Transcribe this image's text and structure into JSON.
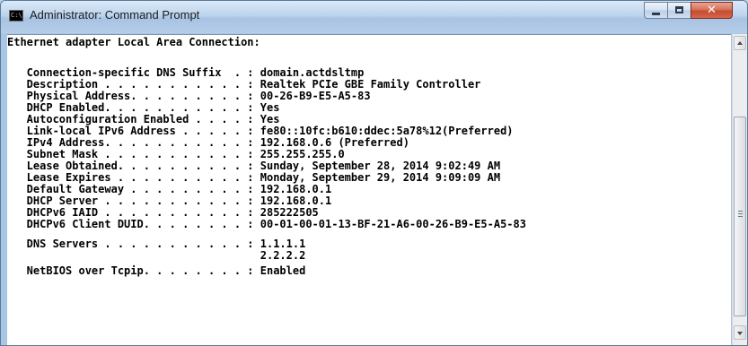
{
  "window": {
    "title": "Administrator: Command Prompt",
    "icon": "cmd-icon",
    "controls": {
      "minimize": "minimize-icon",
      "maximize": "maximize-icon",
      "close": "✕"
    }
  },
  "console": {
    "lines": [
      "Ethernet adapter Local Area Connection:",
      "",
      "   Connection-specific DNS Suffix  . : domain.actdsltmp",
      "   Description . . . . . . . . . . . : Realtek PCIe GBE Family Controller",
      "   Physical Address. . . . . . . . . : 00-26-B9-E5-A5-83",
      "   DHCP Enabled. . . . . . . . . . . : Yes",
      "   Autoconfiguration Enabled . . . . : Yes",
      "   Link-local IPv6 Address . . . . . : fe80::10fc:b610:ddec:5a78%12(Preferred)",
      "   IPv4 Address. . . . . . . . . . . : 192.168.0.6 (Preferred)",
      "   Subnet Mask . . . . . . . . . . . : 255.255.255.0",
      "   Lease Obtained. . . . . . . . . . : Sunday, September 28, 2014 9:02:49 AM",
      "   Lease Expires . . . . . . . . . . : Monday, September 29, 2014 9:09:09 AM",
      "   Default Gateway . . . . . . . . . : 192.168.0.1",
      "   DHCP Server . . . . . . . . . . . : 192.168.0.1",
      "   DHCPv6 IAID . . . . . . . . . . . : 285222505",
      "   DHCPv6 Client DUID. . . . . . . . : 00-01-00-01-13-BF-21-A6-00-26-B9-E5-A5-83",
      "",
      "   DNS Servers . . . . . . . . . . . : 1.1.1.1",
      "                                       2.2.2.2",
      "   NetBIOS over Tcpip. . . . . . . . : Enabled"
    ]
  }
}
